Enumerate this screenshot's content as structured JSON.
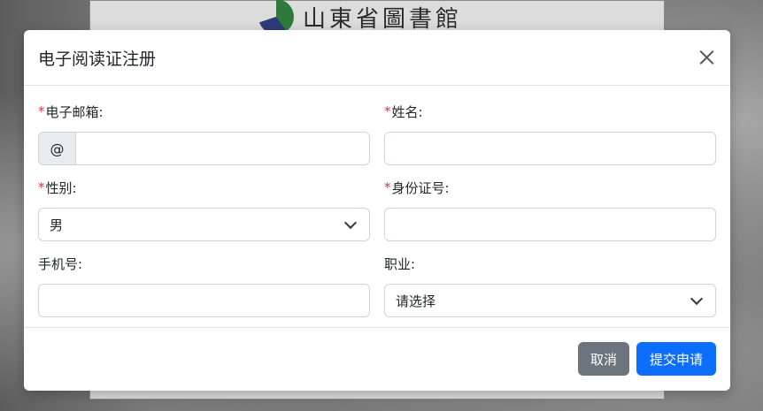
{
  "background": {
    "logo_text": "山東省圖書館"
  },
  "modal": {
    "title": "电子阅读证注册",
    "close_icon": "close-icon",
    "fields": {
      "email": {
        "required_mark": "*",
        "label": "电子邮箱:",
        "addon": "@",
        "value": ""
      },
      "name": {
        "required_mark": "*",
        "label": "姓名:",
        "value": ""
      },
      "gender": {
        "required_mark": "*",
        "label": "性别:",
        "value": "男"
      },
      "id_number": {
        "required_mark": "*",
        "label": "身份证号:",
        "value": ""
      },
      "phone": {
        "label": "手机号:",
        "value": ""
      },
      "occupation": {
        "label": "职业:",
        "value": "请选择"
      }
    },
    "buttons": {
      "cancel": "取消",
      "submit": "提交申请"
    }
  },
  "colors": {
    "primary": "#0d6efd",
    "secondary": "#6c757d",
    "required": "#dc3545"
  }
}
